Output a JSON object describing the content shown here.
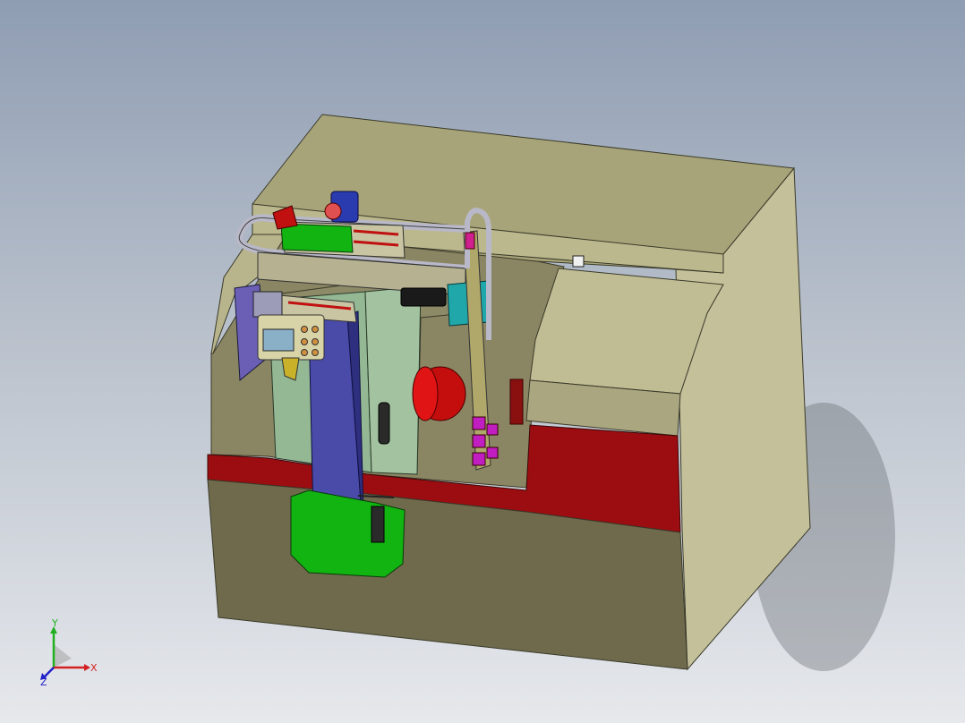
{
  "triad": {
    "x_label": "X",
    "y_label": "Y",
    "z_label": "Z"
  },
  "colors": {
    "background_top": "#8f9db3",
    "background_bottom": "#e6e8ec",
    "cabinet_top": "#a8a479",
    "cabinet_front": "#7a7455",
    "cabinet_side": "#c7c39a",
    "red_stripe": "#9b0d10",
    "green_parts": "#11b411",
    "blue_column": "#4a4aa8",
    "door_green": "#93b893",
    "teal_box": "#1fa7aa",
    "motor_red": "#c40d0d",
    "axis_x": "#d42020",
    "axis_y": "#20b020",
    "axis_z": "#2020c8"
  }
}
